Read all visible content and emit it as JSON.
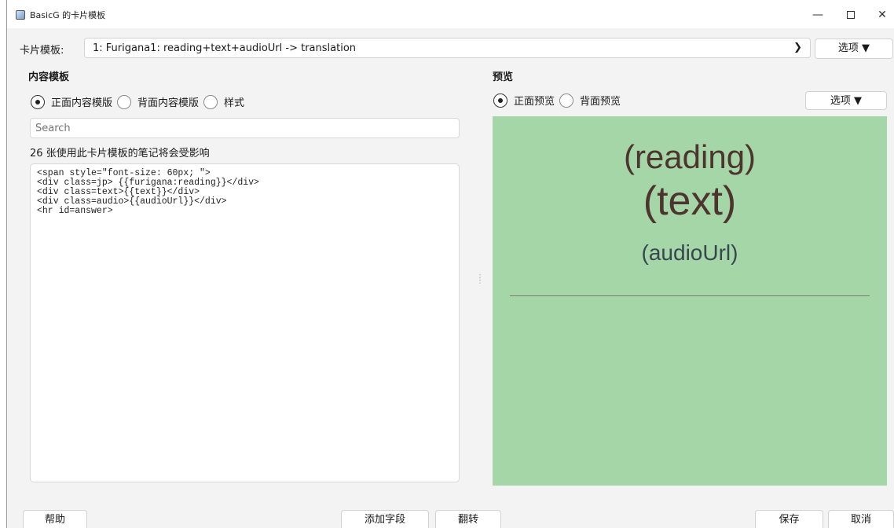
{
  "window": {
    "title": "BasicG 的卡片模板",
    "minimize_glyph": "—",
    "close_glyph": "✕"
  },
  "template_row": {
    "label": "卡片模板:",
    "selected": "1: Furigana1: reading+text+audioUrl -> translation",
    "options_button": "选项 ▼"
  },
  "content_panel": {
    "heading": "内容模板",
    "radios": [
      {
        "label": "正面内容模版",
        "checked": true
      },
      {
        "label": "背面内容模版",
        "checked": false
      },
      {
        "label": "样式",
        "checked": false
      }
    ],
    "search_placeholder": "Search",
    "notes_affected": "26 张使用此卡片模板的笔记将会受影响",
    "editor_text": "<span style=\"font-size: 60px; \">\n<div class=jp> {{furigana:reading}}</div>\n<div class=text>{{text}}</div>\n<div class=audio>{{audioUrl}}</div>\n<hr id=answer>"
  },
  "preview_panel": {
    "heading": "预览",
    "radios": [
      {
        "label": "正面预览",
        "checked": true
      },
      {
        "label": "背面预览",
        "checked": false
      }
    ],
    "options_button": "选项 ▼",
    "reading": "(reading)",
    "text": "(text)",
    "audio": "(audioUrl)",
    "background_color": "#a5d6a7"
  },
  "bottom": {
    "help": "帮助",
    "add_field": "添加字段",
    "flip": "翻转",
    "save": "保存",
    "cancel": "取消"
  }
}
